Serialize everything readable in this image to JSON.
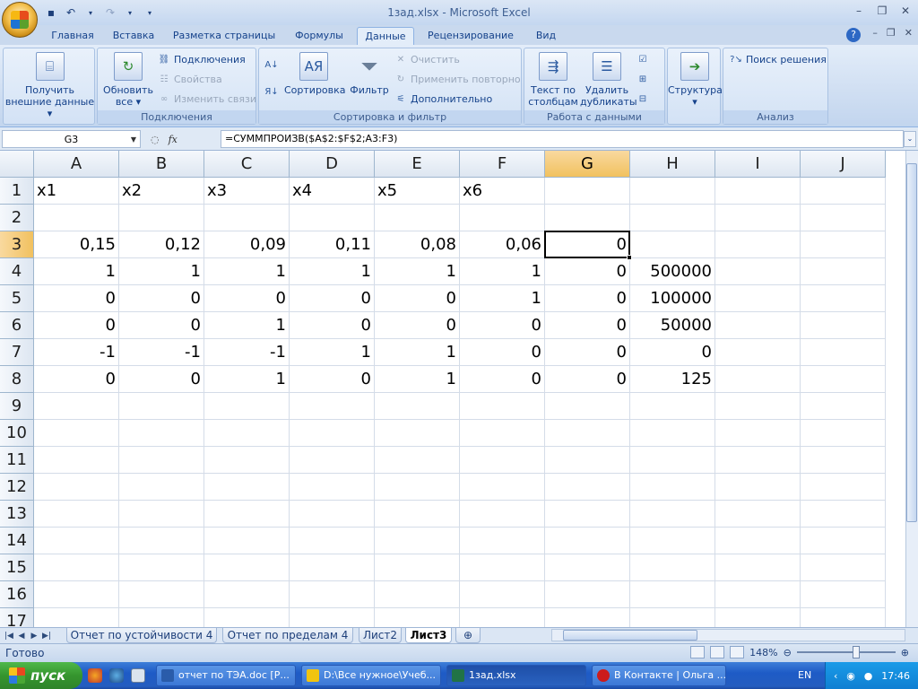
{
  "window": {
    "title": "1зад.xlsx - Microsoft Excel"
  },
  "qat": {
    "save_icon": "save-icon",
    "undo_icon": "undo-icon",
    "redo_icon": "redo-icon"
  },
  "tabs": [
    "Главная",
    "Вставка",
    "Разметка страницы",
    "Формулы",
    "Данные",
    "Рецензирование",
    "Вид"
  ],
  "active_tab": "Данные",
  "ribbon": {
    "get_external": {
      "line1": "Получить",
      "line2": "внешние данные ▾"
    },
    "refresh_all": {
      "line1": "Обновить",
      "line2": "все ▾"
    },
    "connections": "Подключения",
    "properties": "Свойства",
    "edit_links": "Изменить связи",
    "group_connections": "Подключения",
    "sort": "Сортировка",
    "filter": "Фильтр",
    "clear": "Очистить",
    "reapply": "Применить повторно",
    "advanced": "Дополнительно",
    "group_sort": "Сортировка и фильтр",
    "text_to_columns": {
      "line1": "Текст по",
      "line2": "столбцам"
    },
    "remove_duplicates": {
      "line1": "Удалить",
      "line2": "дубликаты"
    },
    "group_data_tools": "Работа с данными",
    "outline": "Структура",
    "solver": "Поиск решения",
    "group_analysis": "Анализ"
  },
  "formula_bar": {
    "name_box": "G3",
    "formula": "=СУММПРОИЗВ($A$2:$F$2;A3:F3)"
  },
  "sheet": {
    "columns": [
      "A",
      "B",
      "C",
      "D",
      "E",
      "F",
      "G",
      "H",
      "I",
      "J"
    ],
    "rows": [
      "1",
      "2",
      "3",
      "4",
      "5",
      "6",
      "7",
      "8",
      "9",
      "10",
      "11",
      "12",
      "13",
      "14",
      "15",
      "16",
      "17"
    ],
    "selected_cell": "G3",
    "cells": [
      [
        "x1",
        "x2",
        "x3",
        "x4",
        "x5",
        "x6",
        "",
        "",
        "",
        ""
      ],
      [
        "",
        "",
        "",
        "",
        "",
        "",
        "",
        "",
        "",
        ""
      ],
      [
        "0,15",
        "0,12",
        "0,09",
        "0,11",
        "0,08",
        "0,06",
        "0",
        "",
        "",
        ""
      ],
      [
        "1",
        "1",
        "1",
        "1",
        "1",
        "1",
        "0",
        "500000",
        "",
        ""
      ],
      [
        "0",
        "0",
        "0",
        "0",
        "0",
        "1",
        "0",
        "100000",
        "",
        ""
      ],
      [
        "0",
        "0",
        "1",
        "0",
        "0",
        "0",
        "0",
        "50000",
        "",
        ""
      ],
      [
        "-1",
        "-1",
        "-1",
        "1",
        "1",
        "0",
        "0",
        "0",
        "",
        ""
      ],
      [
        "0",
        "0",
        "1",
        "0",
        "1",
        "0",
        "0",
        "125",
        "",
        ""
      ]
    ]
  },
  "sheet_tabs": [
    "Отчет по устойчивости 4",
    "Отчет по пределам 4",
    "Лист2",
    "Лист3"
  ],
  "active_sheet": "Лист3",
  "status": {
    "ready": "Готово",
    "zoom": "148%"
  },
  "taskbar": {
    "start": "пуск",
    "items": [
      "отчет по ТЭА.doc [Р...",
      "D:\\Все нужное\\Учеб...",
      "1зад.xlsx",
      "В Контакте | Ольга ..."
    ],
    "lang": "EN",
    "time": "17:46"
  }
}
